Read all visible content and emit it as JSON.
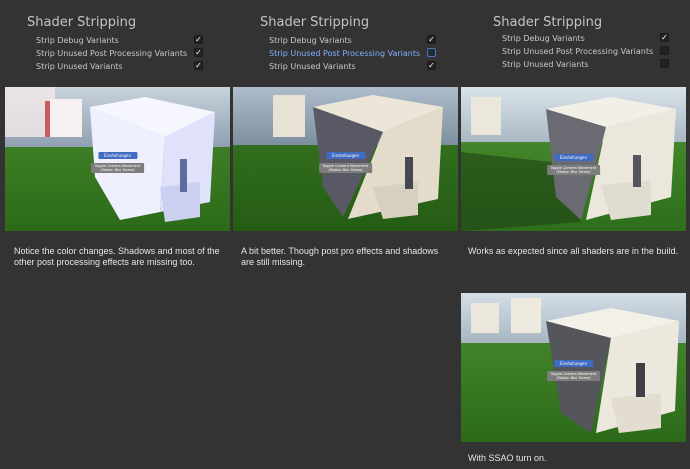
{
  "panels": [
    {
      "title": "Shader Stripping",
      "options": [
        {
          "label": "Strip Debug Variants",
          "checked": true,
          "highlight": false
        },
        {
          "label": "Strip Unused Post Processing Variants",
          "checked": true,
          "highlight": false
        },
        {
          "label": "Strip Unused Variants",
          "checked": true,
          "highlight": false
        }
      ]
    },
    {
      "title": "Shader Stripping",
      "options": [
        {
          "label": "Strip Debug Variants",
          "checked": true,
          "highlight": false
        },
        {
          "label": "Strip Unused Post Processing Variants",
          "checked": false,
          "highlight": true
        },
        {
          "label": "Strip Unused Variants",
          "checked": true,
          "highlight": false
        }
      ]
    },
    {
      "title": "Shader Stripping",
      "options": [
        {
          "label": "Strip Debug Variants",
          "checked": true,
          "highlight": false
        },
        {
          "label": "Strip Unused Post Processing Variants",
          "checked": false,
          "highlight": false
        },
        {
          "label": "Strip Unused Variants",
          "checked": false,
          "highlight": false
        }
      ]
    }
  ],
  "checkmark": "✓",
  "shots": [
    {
      "button": "Einstellungen",
      "toggle_line1": "Toggle Camera Movement",
      "toggle_line2": "(Motion Blur Demo)"
    },
    {
      "button": "Einstellungen",
      "toggle_line1": "Toggle Camera Movement",
      "toggle_line2": "(Motion Blur Demo)"
    },
    {
      "button": "Einstellungen",
      "toggle_line1": "Toggle Camera Movement",
      "toggle_line2": "(Motion Blur Demo)"
    },
    {
      "button": "Einstellungen",
      "toggle_line1": "Toggle Camera Movement",
      "toggle_line2": "(Motion Blur Demo)"
    }
  ],
  "captions": [
    "Notice the color changes. Shadows and most of the other post processing effects are missing too.",
    "A bit better. Though post pro effects and shadows are still missing.",
    "Works as expected since all shaders are in the build.",
    "With SSAO turn on."
  ],
  "colors": {
    "background": "#333333",
    "grass": "#2f6a1f",
    "accent_blue": "#3f6bc2"
  }
}
